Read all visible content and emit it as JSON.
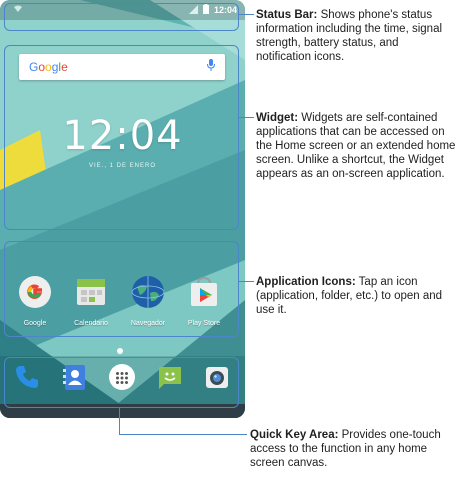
{
  "status_bar": {
    "time": "12:04"
  },
  "search_widget": {
    "brand": "Google"
  },
  "clock_widget": {
    "time": "12:04",
    "date": "VIE., 1 DE ENERO"
  },
  "apps": [
    {
      "name": "google-app",
      "label": "Google"
    },
    {
      "name": "calendar-app",
      "label": "Calendario"
    },
    {
      "name": "browser-app",
      "label": "Navegador"
    },
    {
      "name": "play-store-app",
      "label": "Play Store"
    }
  ],
  "dock": [
    {
      "name": "phone-icon"
    },
    {
      "name": "contacts-icon"
    },
    {
      "name": "app-drawer-icon"
    },
    {
      "name": "messaging-icon"
    },
    {
      "name": "camera-icon"
    }
  ],
  "annotations": {
    "status_bar": {
      "title": "Status Bar:",
      "text": "Shows phone's status information including the time, signal strength, battery status, and notification icons."
    },
    "widget": {
      "title": "Widget:",
      "text": "Widgets are self-contained applications that can be accessed on the Home screen or an extended home screen. Unlike a shortcut, the Widget appears as an on-screen application."
    },
    "application_icons": {
      "title": "Application Icons:",
      "text": "Tap an icon (application, folder, etc.) to open and use it."
    },
    "quick_key_area": {
      "title": "Quick Key Area:",
      "text": "Provides one-touch access to the function in any home screen canvas."
    }
  },
  "colors": {
    "callout": "#4c86c8",
    "wallpaper_teal": "#7cc7c2",
    "wallpaper_dark": "#3f8f92",
    "accent_yellow": "#eddc3c"
  }
}
